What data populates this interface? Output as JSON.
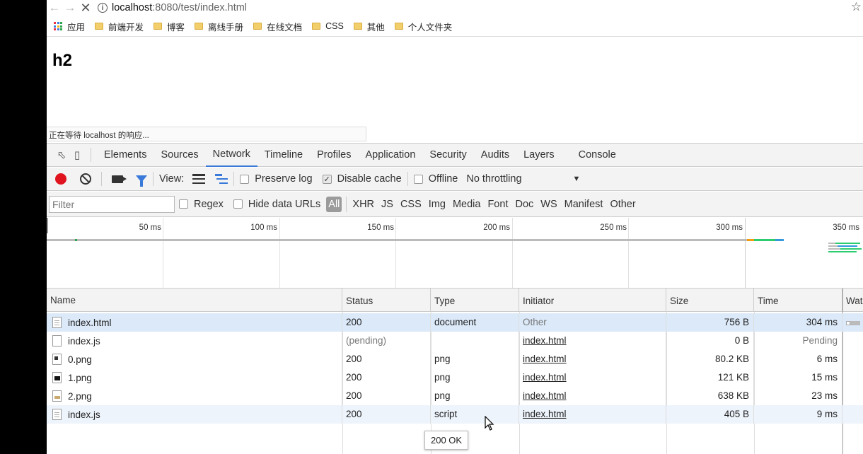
{
  "browser": {
    "url_host": "localhost",
    "url_path": ":8080/test/index.html",
    "star_icon": "star-icon"
  },
  "bookmarks": [
    {
      "label": "应用",
      "icon": "apps-icon"
    },
    {
      "label": "前端开发",
      "icon": "folder-icon"
    },
    {
      "label": "博客",
      "icon": "folder-icon"
    },
    {
      "label": "离线手册",
      "icon": "folder-icon"
    },
    {
      "label": "在线文档",
      "icon": "folder-icon"
    },
    {
      "label": "CSS",
      "icon": "folder-icon"
    },
    {
      "label": "其他",
      "icon": "folder-icon"
    },
    {
      "label": "个人文件夹",
      "icon": "folder-icon"
    }
  ],
  "page": {
    "heading": "h2",
    "status_text": "正在等待 localhost 的响应..."
  },
  "devtools": {
    "tabs": [
      "Elements",
      "Sources",
      "Network",
      "Timeline",
      "Profiles",
      "Application",
      "Security",
      "Audits",
      "Layers",
      "Console"
    ],
    "active_tab": "Network",
    "toolbar": {
      "view_label": "View:",
      "preserve_log": "Preserve log",
      "preserve_log_checked": false,
      "disable_cache": "Disable cache",
      "disable_cache_checked": true,
      "offline": "Offline",
      "offline_checked": false,
      "throttling": "No throttling"
    },
    "filter_bar": {
      "filter_placeholder": "Filter",
      "regex": "Regex",
      "hide_data_urls": "Hide data URLs",
      "types": [
        "All",
        "XHR",
        "JS",
        "CSS",
        "Img",
        "Media",
        "Font",
        "Doc",
        "WS",
        "Manifest",
        "Other"
      ],
      "active_type": "All"
    },
    "overview_ticks": [
      "50 ms",
      "100 ms",
      "150 ms",
      "200 ms",
      "250 ms",
      "300 ms",
      "350 ms"
    ],
    "columns": [
      "Name",
      "Status",
      "Type",
      "Initiator",
      "Size",
      "Time",
      "Wat"
    ],
    "rows": [
      {
        "name": "index.html",
        "status": "200",
        "type": "document",
        "initiator": "Other",
        "size": "756 B",
        "time": "304 ms",
        "icon": "document-icon"
      },
      {
        "name": "index.js",
        "status": "(pending)",
        "type": "",
        "initiator": "index.html",
        "size": "0 B",
        "time": "Pending",
        "icon": "file-icon"
      },
      {
        "name": "0.png",
        "status": "200",
        "type": "png",
        "initiator": "index.html",
        "size": "80.2 KB",
        "time": "6 ms",
        "icon": "image-icon"
      },
      {
        "name": "1.png",
        "status": "200",
        "type": "png",
        "initiator": "index.html",
        "size": "121 KB",
        "time": "15 ms",
        "icon": "image-icon"
      },
      {
        "name": "2.png",
        "status": "200",
        "type": "png",
        "initiator": "index.html",
        "size": "638 KB",
        "time": "23 ms",
        "icon": "image-icon"
      },
      {
        "name": "index.js",
        "status": "200",
        "type": "script",
        "initiator": "index.html",
        "size": "405 B",
        "time": "9 ms",
        "icon": "script-icon"
      }
    ],
    "tooltip": "200 OK"
  }
}
